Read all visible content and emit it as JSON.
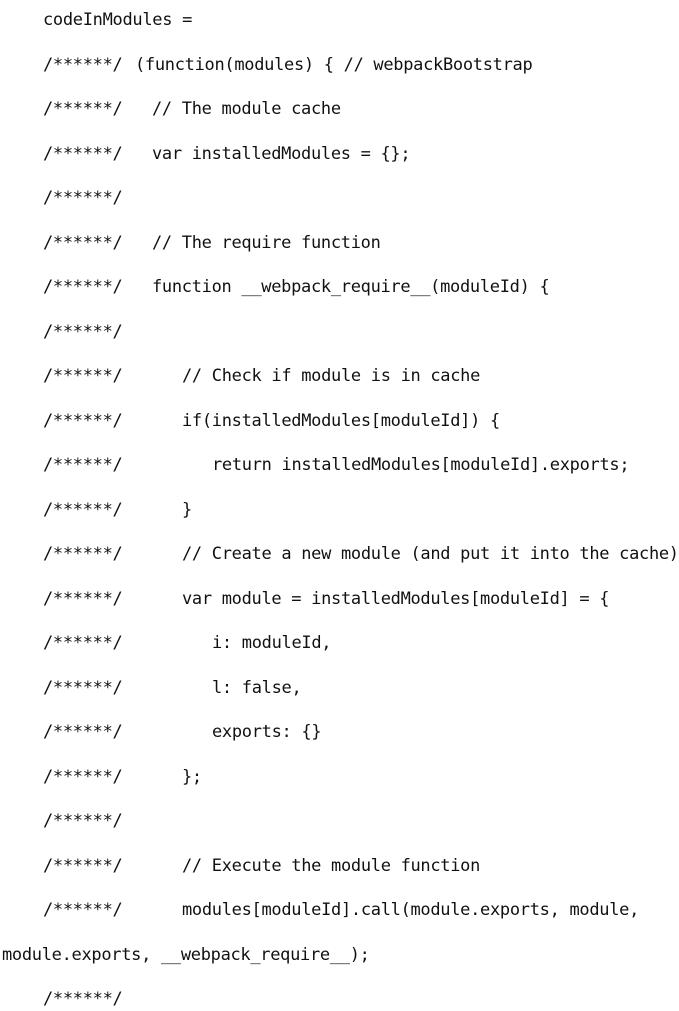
{
  "document": {
    "marker": "/******/",
    "lines": [
      {
        "marker": false,
        "indent": "lvl-0",
        "text": "codeInModules ="
      },
      {
        "marker": true,
        "indent": "lvl-h",
        "text": "(function(modules) { // webpackBootstrap"
      },
      {
        "marker": true,
        "indent": "lvl-1",
        "text": "// The module cache"
      },
      {
        "marker": true,
        "indent": "lvl-1",
        "text": "var installedModules = {};"
      },
      {
        "marker": true,
        "indent": "lvl-1",
        "text": ""
      },
      {
        "marker": true,
        "indent": "lvl-1",
        "text": "// The require function"
      },
      {
        "marker": true,
        "indent": "lvl-1",
        "text": "function __webpack_require__(moduleId) {"
      },
      {
        "marker": true,
        "indent": "lvl-1",
        "text": ""
      },
      {
        "marker": true,
        "indent": "lvl-2",
        "text": "// Check if module is in cache"
      },
      {
        "marker": true,
        "indent": "lvl-2",
        "text": "if(installedModules[moduleId]) {"
      },
      {
        "marker": true,
        "indent": "lvl-3",
        "text": "return installedModules[moduleId].exports;"
      },
      {
        "marker": true,
        "indent": "lvl-2",
        "text": "}"
      },
      {
        "marker": true,
        "indent": "lvl-2",
        "text": "// Create a new module (and put it into the cache)"
      },
      {
        "marker": true,
        "indent": "lvl-2",
        "text": "var module = installedModules[moduleId] = {"
      },
      {
        "marker": true,
        "indent": "lvl-3",
        "text": "i: moduleId,"
      },
      {
        "marker": true,
        "indent": "lvl-3",
        "text": "l: false,"
      },
      {
        "marker": true,
        "indent": "lvl-3",
        "text": "exports: {}"
      },
      {
        "marker": true,
        "indent": "lvl-2",
        "text": "};"
      },
      {
        "marker": true,
        "indent": "lvl-2",
        "text": ""
      },
      {
        "marker": true,
        "indent": "lvl-2",
        "text": "// Execute the module function"
      },
      {
        "marker": true,
        "indent": "lvl-2",
        "text": "modules[moduleId].call(module.exports, module,"
      },
      {
        "marker": false,
        "indent": "lvl-wrap",
        "text": "module.exports, __webpack_require__);"
      },
      {
        "marker": true,
        "indent": "lvl-2",
        "text": ""
      }
    ]
  }
}
